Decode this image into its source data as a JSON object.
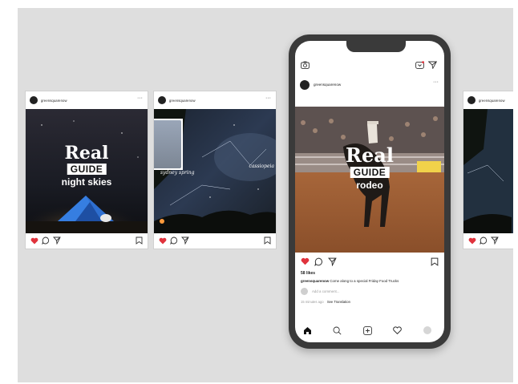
{
  "colors": {
    "background": "#dedede",
    "like_red": "#e0323c",
    "phone_frame": "#3a3a3a"
  },
  "cards": [
    {
      "username": "greensquarenow",
      "title_real": "Real",
      "title_guide": "GUIDE",
      "subtitle": "night skies"
    },
    {
      "username": "greensquarenow",
      "caption_left": "sydney spring",
      "caption_right": "cassiopeia"
    },
    {
      "username": "greensquarenow"
    }
  ],
  "phone": {
    "username": "greensquarenow",
    "post": {
      "title_real": "Real",
      "title_guide": "GUIDE",
      "subtitle": "rodeo",
      "likes": "58 likes",
      "caption_user": "greensquarenow",
      "caption_text": "Come along to a special Friday Food Trucks",
      "comment_placeholder": "Add a comment...",
      "time": "15 minutes ago",
      "see_translation": "See Translation"
    },
    "icons": {
      "top_left": "camera-icon",
      "top_right": [
        "igtv-icon",
        "direct-send-icon"
      ],
      "post_actions": [
        "heart-icon",
        "comment-icon",
        "share-icon",
        "bookmark-icon"
      ],
      "bottom_nav": [
        "home-icon",
        "search-icon",
        "add-post-icon",
        "activity-heart-icon",
        "profile-avatar"
      ]
    }
  }
}
